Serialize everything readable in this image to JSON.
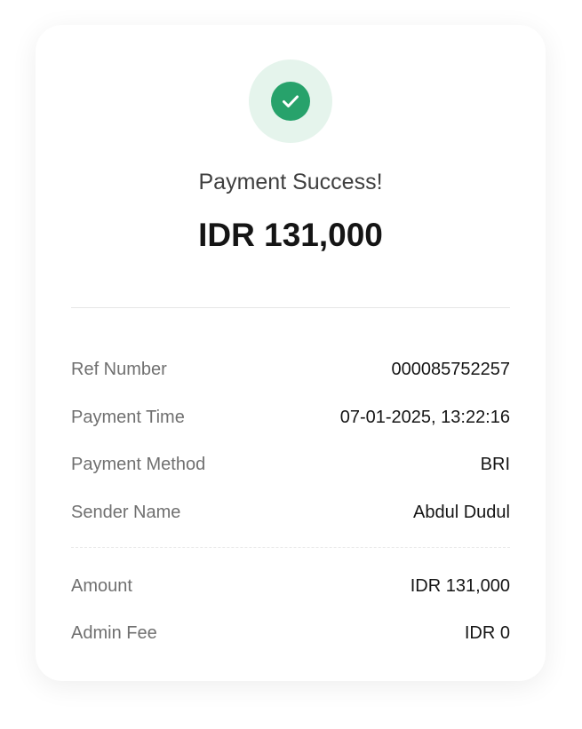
{
  "status": {
    "icon": "check-circle-icon",
    "title": "Payment Success!",
    "amount": "IDR 131,000",
    "accent": "#27a26b"
  },
  "details": [
    {
      "label": "Ref Number",
      "value": "000085752257"
    },
    {
      "label": "Payment Time",
      "value": "07-01-2025, 13:22:16"
    },
    {
      "label": "Payment Method",
      "value": "BRI"
    },
    {
      "label": "Sender Name",
      "value": "Abdul Dudul"
    }
  ],
  "summary": [
    {
      "label": "Amount",
      "value": "IDR 131,000"
    },
    {
      "label": "Admin Fee",
      "value": "IDR 0"
    }
  ]
}
